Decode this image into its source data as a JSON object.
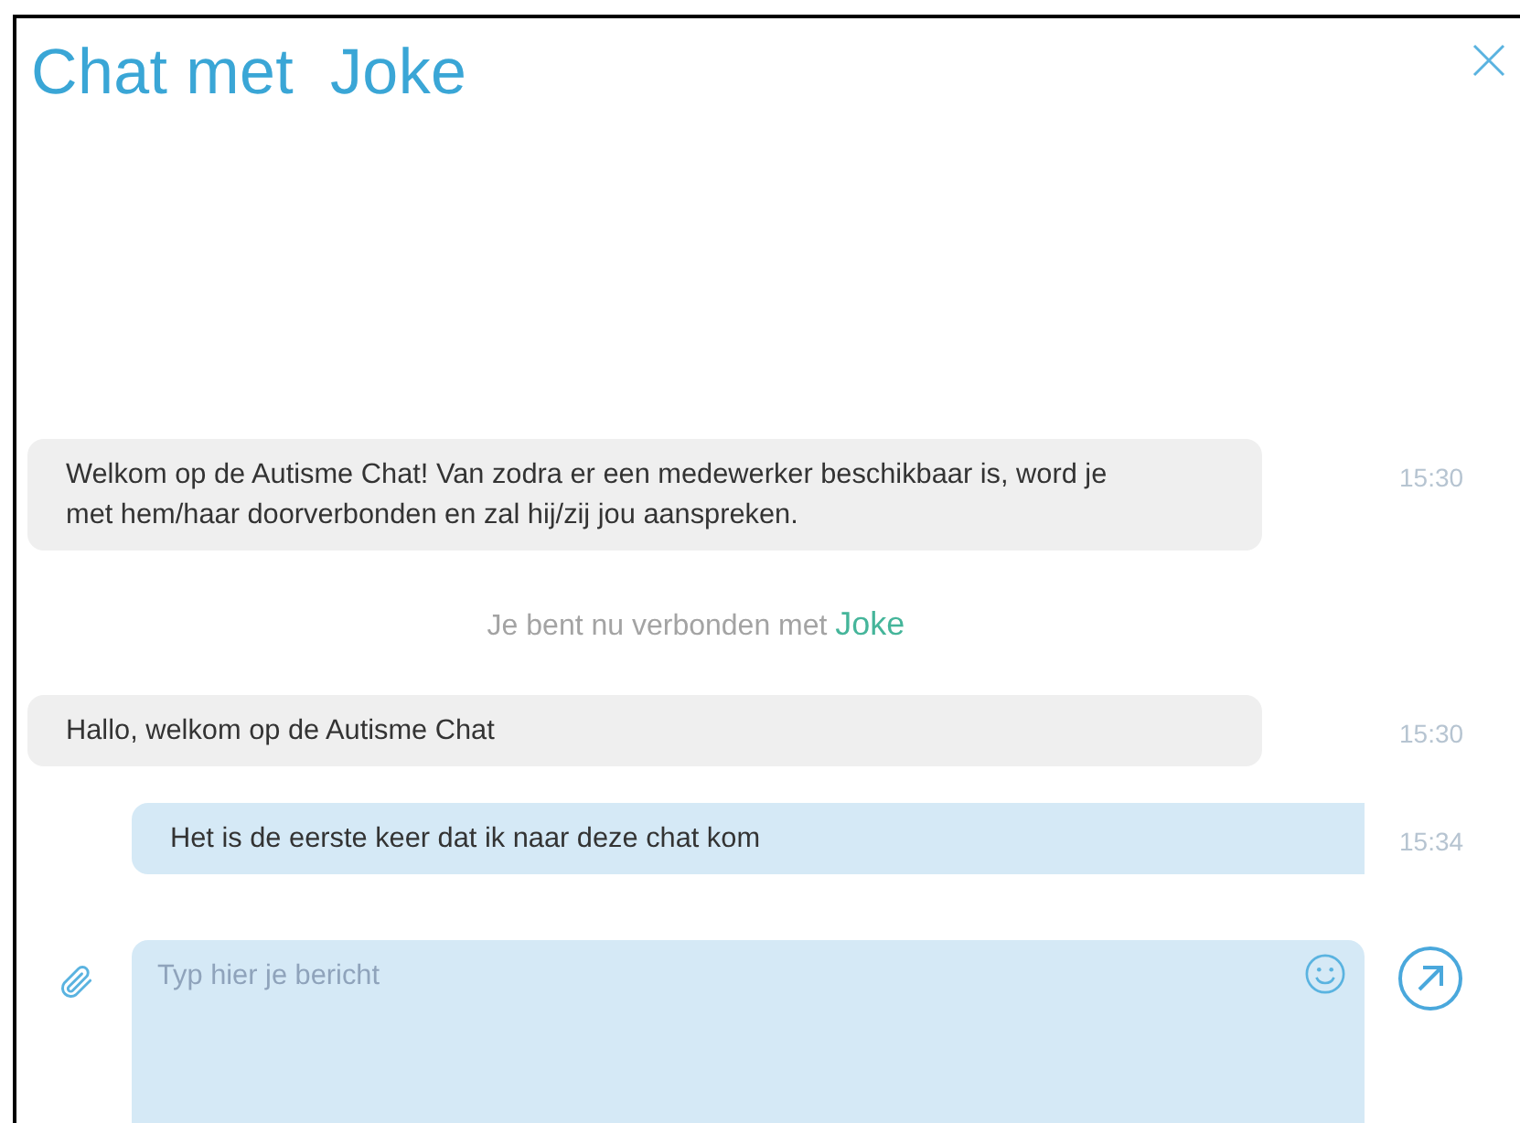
{
  "title": "Chat met  Joke",
  "messages": [
    {
      "kind": "agent",
      "text": "Welkom op de Autisme Chat! Van zodra er een medewerker beschikbaar is, word je met hem/haar doorverbonden en zal hij/zij jou aanspreken.",
      "time": "15:30"
    },
    {
      "kind": "system",
      "text": "Je bent nu verbonden met",
      "name": "Joke"
    },
    {
      "kind": "agent",
      "text": "Hallo, welkom op de Autisme Chat",
      "time": "15:30"
    },
    {
      "kind": "user",
      "text": "Het is de eerste keer dat ik naar deze chat kom",
      "time": "15:34"
    }
  ],
  "composer": {
    "placeholder": "Typ hier je bericht"
  }
}
